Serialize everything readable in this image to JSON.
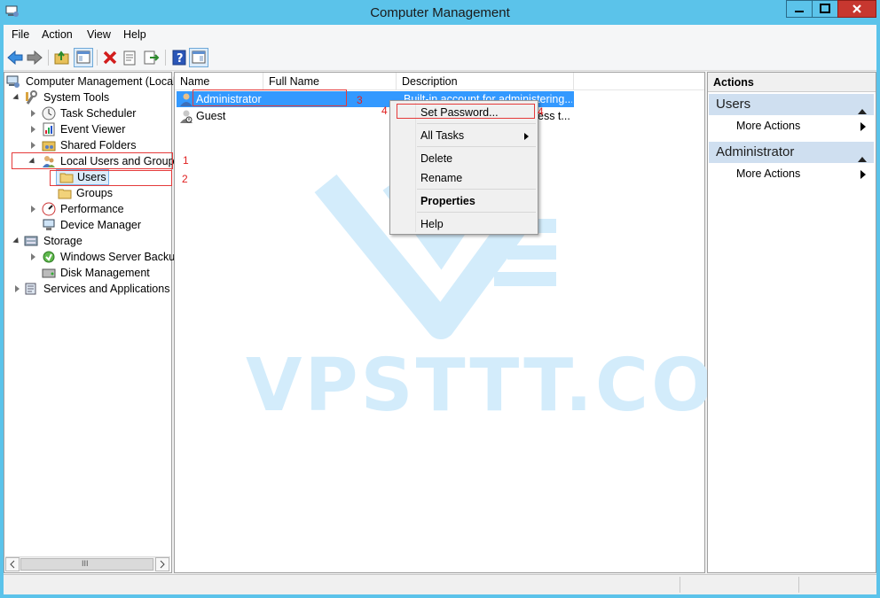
{
  "window": {
    "title": "Computer Management"
  },
  "menu": [
    "File",
    "Action",
    "View",
    "Help"
  ],
  "tree": {
    "root": "Computer Management (Local",
    "system_tools": "System Tools",
    "task_scheduler": "Task Scheduler",
    "event_viewer": "Event Viewer",
    "shared_folders": "Shared Folders",
    "local_users_groups": "Local Users and Groups",
    "users": "Users",
    "groups": "Groups",
    "performance": "Performance",
    "device_manager": "Device Manager",
    "storage": "Storage",
    "windows_server_backup": "Windows Server Backup",
    "disk_management": "Disk Management",
    "services_apps": "Services and Applications"
  },
  "list": {
    "columns": [
      "Name",
      "Full Name",
      "Description"
    ],
    "rows": [
      {
        "name": "Administrator",
        "full_name": "",
        "description": "Built-in account for administering..."
      },
      {
        "name": "Guest",
        "full_name": "",
        "description": "ess t..."
      }
    ]
  },
  "context_menu": {
    "set_password": "Set Password...",
    "all_tasks": "All Tasks",
    "delete": "Delete",
    "rename": "Rename",
    "properties": "Properties",
    "help": "Help"
  },
  "actions": {
    "header": "Actions",
    "section1": "Users",
    "section1_more": "More Actions",
    "section2": "Administrator",
    "section2_more": "More Actions"
  },
  "annotations": {
    "n1": "1",
    "n2": "2",
    "n3": "3",
    "n4a": "4",
    "n4b": "4"
  },
  "watermark": "VPSTTT.COM",
  "scrollbar": {
    "thumb_glyph": "III"
  },
  "colors": {
    "titlebar": "#5bc3ea",
    "selection": "#3399ff",
    "annotation": "#e53a3a",
    "action_header": "#cfdff0"
  }
}
